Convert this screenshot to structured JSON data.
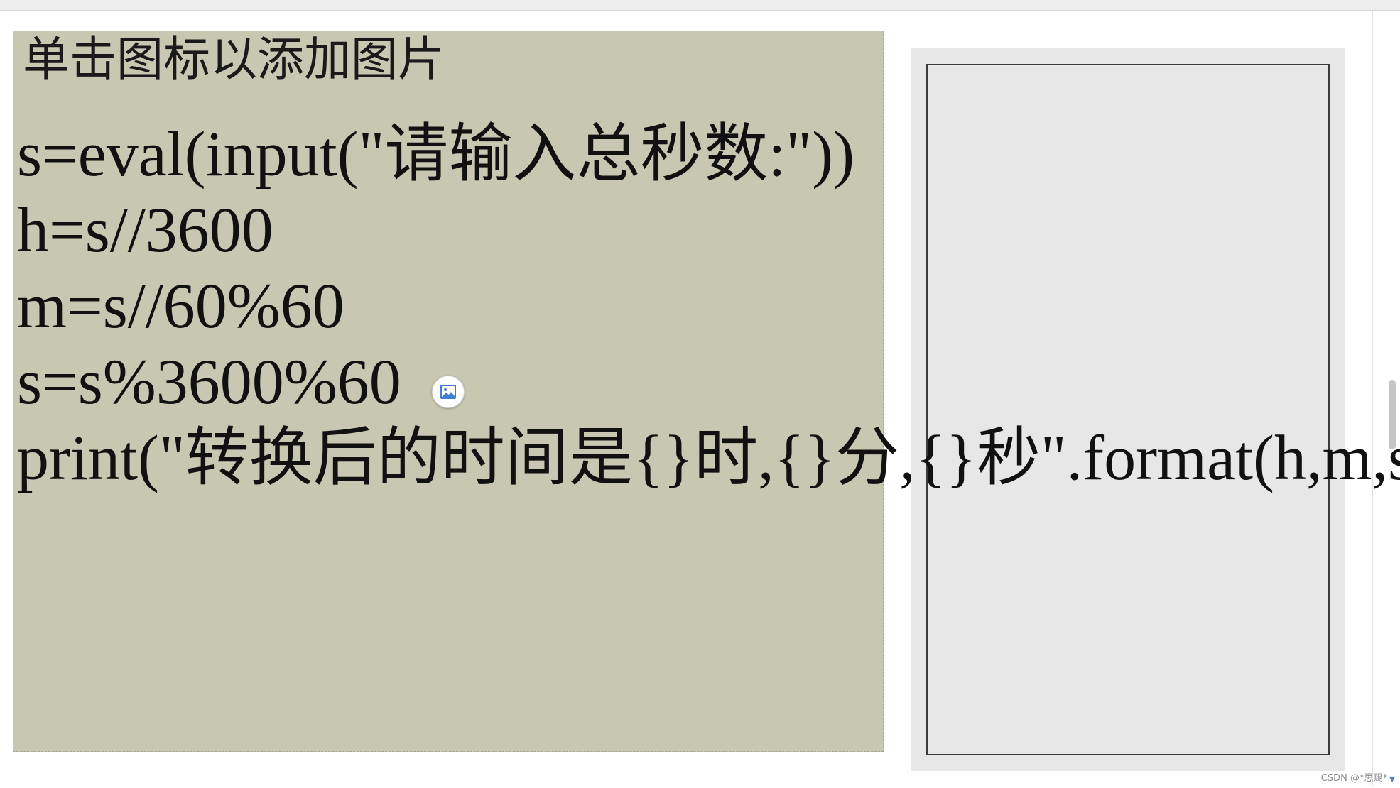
{
  "placeholder": {
    "prompt": "单击图标以添加图片"
  },
  "code": {
    "lines": [
      "s=eval(input(\"请输入总秒数:\"))",
      "h=s//3600",
      "m=s//60%60",
      "s=s%3600%60",
      "print(\"转换后的时间是{}时,{}分,{}秒\".format(h,m,s)"
    ]
  },
  "insert_picture": {
    "icon": "image-icon"
  },
  "watermark": {
    "text": "CSDN @*思赐*"
  },
  "colors": {
    "placeholder_bg": "#c8c7b1",
    "side_panel_bg": "#e7e7e7",
    "icon_accent": "#3f7fd6"
  }
}
